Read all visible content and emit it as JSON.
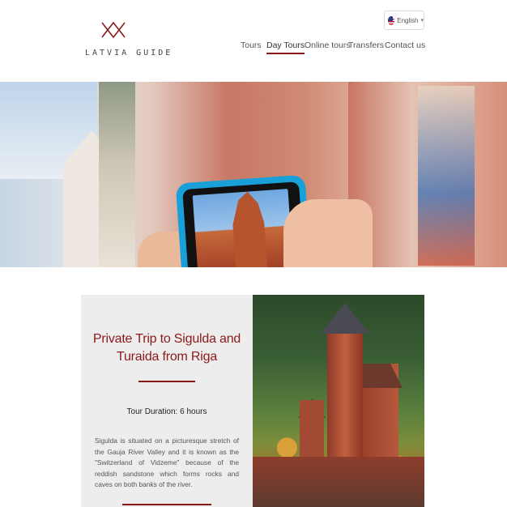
{
  "header": {
    "logo_text": "LATVIA GUIDE",
    "language": "English"
  },
  "nav": {
    "items": [
      {
        "label": "Tours"
      },
      {
        "label": "Day Tours",
        "active": true
      },
      {
        "label": "Online tours"
      },
      {
        "label": "Transfers"
      },
      {
        "label": "Contact us"
      }
    ]
  },
  "tour": {
    "title": "Private Trip to Sigulda and Turaida from Riga",
    "duration": "Tour Duration: 6 hours",
    "description": "Sigulda is situated on a picturesque stretch of the Gauja River Valley and it is known as the \"Switzerland of Vidzeme\" because of the reddish sandstone which forms rocks and caves on both banks of the river."
  },
  "colors": {
    "accent": "#8b1a1a"
  },
  "icons": {
    "language_flag": "us-flag-icon",
    "language_dropdown": "chevron-down-icon",
    "logo": "latvia-guide-logo"
  }
}
